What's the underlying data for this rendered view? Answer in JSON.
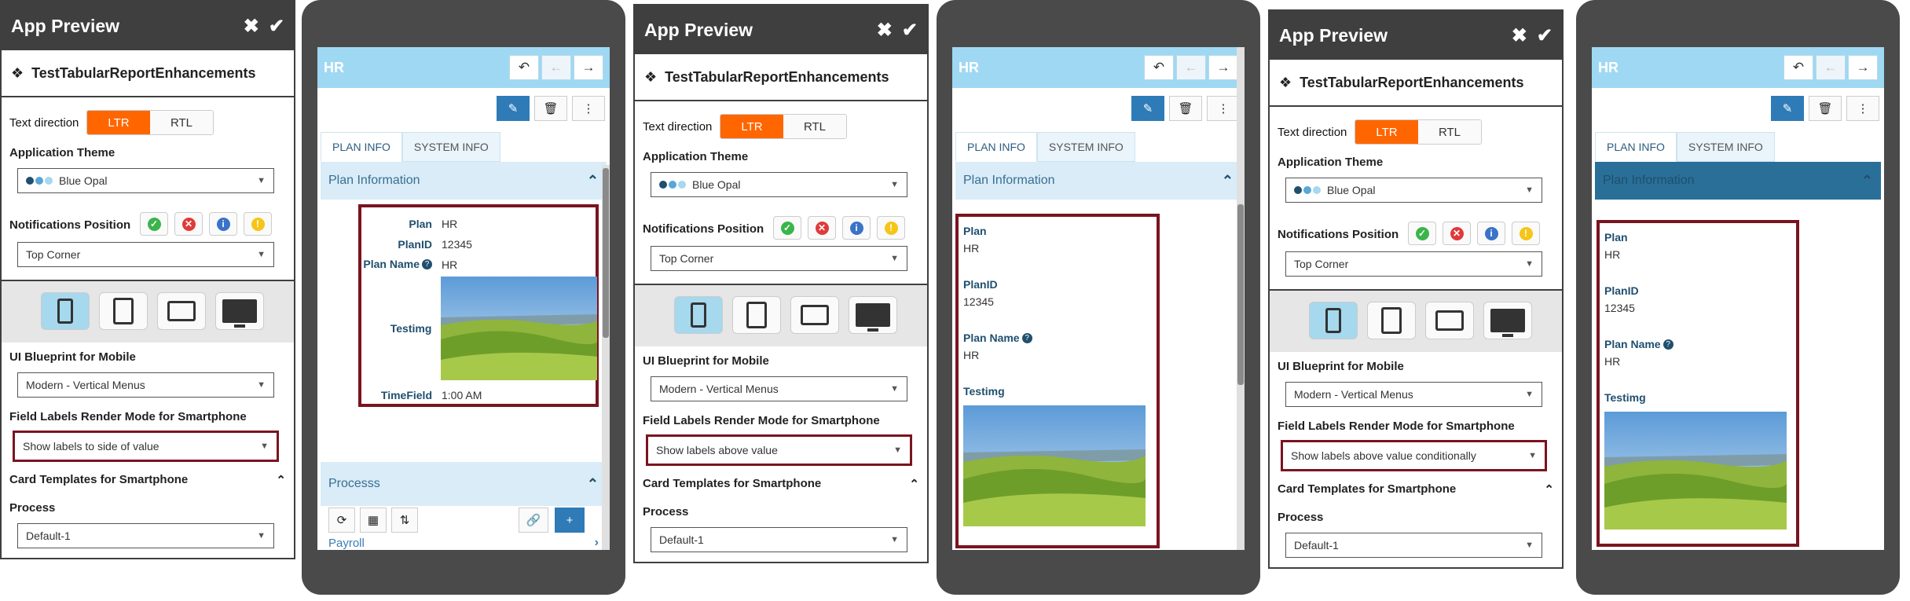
{
  "settings": {
    "title": "App Preview",
    "close_icon": "close-icon",
    "confirm_icon": "check-icon",
    "app_icon": "cubes-icon",
    "app_name": "TestTabularReportEnhancements",
    "text_direction_label": "Text direction",
    "ltr": "LTR",
    "rtl": "RTL",
    "theme_label": "Application Theme",
    "theme_value": "Blue Opal",
    "theme_colors": [
      "#1f4f6e",
      "#5aa6d6",
      "#a6d8ee"
    ],
    "notifications_label": "Notifications Position",
    "notification_icons": [
      "check-circle-icon",
      "times-circle-icon",
      "info-circle-icon",
      "exclamation-circle-icon"
    ],
    "notification_colors": [
      "#3bb54a",
      "#e03a3a",
      "#3a73c8",
      "#f5c518"
    ],
    "notification_symbols": [
      "✓",
      "✕",
      "i",
      "!"
    ],
    "notifications_value": "Top Corner",
    "devices": [
      "phone-icon",
      "tablet-icon",
      "tablet-landscape-icon",
      "desktop-icon"
    ],
    "blueprint_label": "UI Blueprint for Mobile",
    "blueprint_value": "Modern - Vertical Menus",
    "render_mode_label": "Field Labels Render Mode for Smartphone",
    "card_templates_label": "Card Templates for Smartphone",
    "process_label": "Process",
    "process_value": "Default-1"
  },
  "panels": [
    {
      "render_mode_value": "Show labels to side of value"
    },
    {
      "render_mode_value": "Show labels above value"
    },
    {
      "render_mode_value": "Show labels above value conditionally"
    }
  ],
  "preview": {
    "title": "HR",
    "back_icon": "undo-icon",
    "prev_icon": "arrow-left-icon",
    "next_icon": "arrow-right-icon",
    "edit_icon": "pencil-icon",
    "delete_icon": "trash-icon",
    "more_icon": "ellipsis-vertical-icon",
    "tab_plan": "PLAN INFO",
    "tab_system": "SYSTEM INFO",
    "section_title": "Plan Information",
    "fields": {
      "plan_label": "Plan",
      "plan_value": "HR",
      "planid_label": "PlanID",
      "planid_value": "12345",
      "planname_label": "Plan Name",
      "planname_value": "HR",
      "testing_label": "Testimg",
      "timefield_label": "TimeField",
      "timefield_value": "1:00 AM"
    },
    "processes_title": "Processs",
    "process_item": "Payroll"
  }
}
